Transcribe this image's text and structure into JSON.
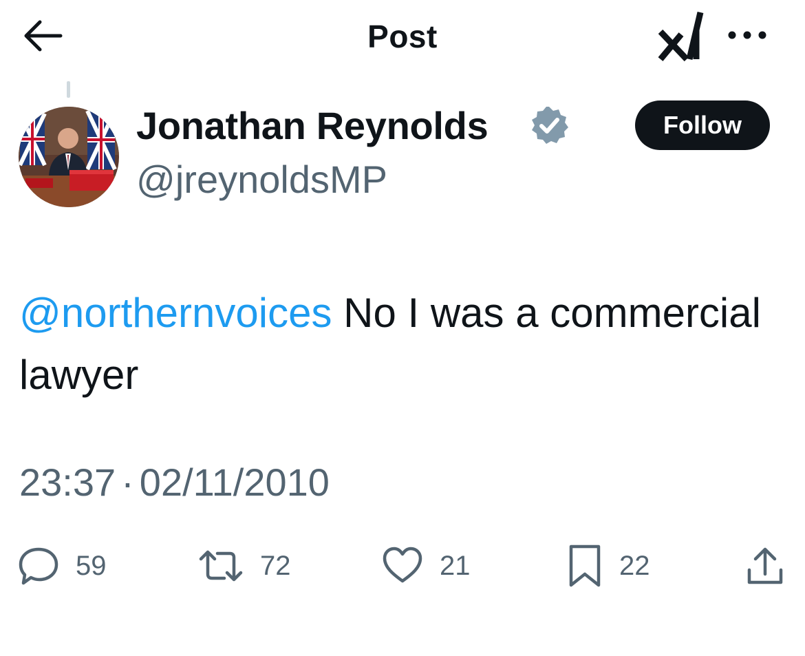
{
  "header": {
    "title": "Post",
    "back_icon": "arrow-left-icon",
    "grok_icon": "xai-grok-icon",
    "more_icon": "more-horizontal-icon"
  },
  "post": {
    "author": {
      "display_name": "Jonathan Reynolds",
      "handle": "@jreynoldsMP",
      "verified_icon": "verified-badge-icon",
      "verified_color": "#829aab"
    },
    "follow_label": "Follow",
    "text": {
      "mention": "@northernvoices",
      "body": " No I was a commercial lawyer"
    },
    "timestamp": {
      "time": "23:37",
      "separator": "·",
      "date": "02/11/2010"
    },
    "actions": {
      "replies": "59",
      "reposts": "72",
      "likes": "21",
      "bookmarks": "22"
    }
  },
  "colors": {
    "accent_link": "#1d9bf0",
    "text_primary": "#0f1419",
    "text_secondary": "#536471"
  }
}
